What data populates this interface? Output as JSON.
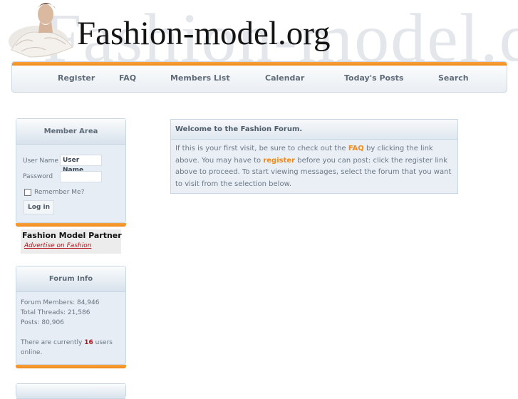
{
  "header": {
    "logo_text": "Fashion-model.org",
    "watermark_text": "Fashion-model.c"
  },
  "nav": {
    "items": [
      "Register",
      "FAQ",
      "Members List",
      "Calendar",
      "Today's Posts",
      "Search"
    ]
  },
  "member_area": {
    "title": "Member Area",
    "username_label": "User Name",
    "username_value": "User Name",
    "password_label": "Password",
    "remember_label": "Remember Me?",
    "login_button": "Log in"
  },
  "partner": {
    "title": "Fashion Model Partner",
    "link": "Advertise on Fashion"
  },
  "forum_info": {
    "title": "Forum Info",
    "members": "Forum Members: 84,946",
    "threads": "Total Threads: 21,586",
    "posts": "Posts: 80,906",
    "online_prefix": "There are currently",
    "online_count": "16",
    "online_suffix": "users",
    "online_tail": "online."
  },
  "welcome": {
    "title": "Welcome to the Fashion Forum.",
    "p1": "If this is your first visit, be sure to check out the",
    "faq": "FAQ",
    "p2": "by clicking the link above. You may have to",
    "register": "register",
    "p3": "before you can post: click the register link above to proceed. To start viewing messages, select the forum that you want to visit from the selection below."
  },
  "colors": {
    "accent_orange": "#f08a18",
    "link_red": "#b3131b",
    "panel_bg": "#e6edf4"
  }
}
